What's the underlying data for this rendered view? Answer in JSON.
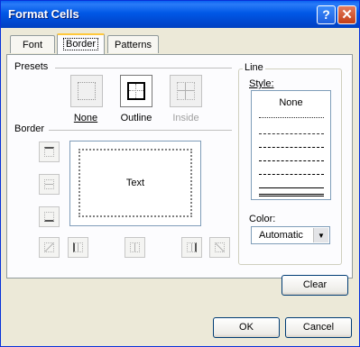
{
  "window": {
    "title": "Format Cells",
    "help_glyph": "?",
    "close_glyph": "✕"
  },
  "tabs": [
    {
      "label": "Font"
    },
    {
      "label": "Border"
    },
    {
      "label": "Patterns"
    }
  ],
  "presets": {
    "heading": "Presets",
    "items": [
      {
        "label": "None"
      },
      {
        "label": "Outline"
      },
      {
        "label": "Inside"
      }
    ]
  },
  "border": {
    "heading": "Border",
    "preview_text": "Text"
  },
  "line": {
    "heading": "Line",
    "style_label": "Style:",
    "style_none": "None",
    "color_label": "Color:",
    "color_value": "Automatic"
  },
  "buttons": {
    "clear": "Clear",
    "ok": "OK",
    "cancel": "Cancel"
  }
}
